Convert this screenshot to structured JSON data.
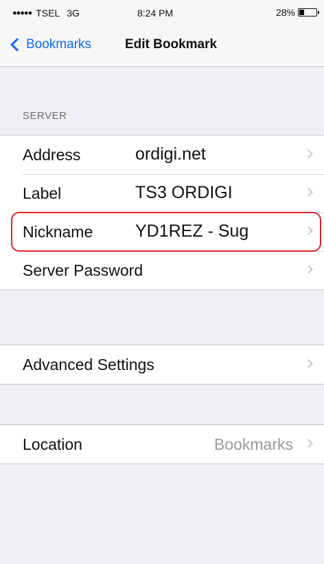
{
  "status_bar": {
    "signal": "●●●●●",
    "carrier": "TSEL",
    "network": "3G",
    "time": "8:24 PM",
    "battery": "28%",
    "battery_level": 0.28
  },
  "nav": {
    "back_label": "Bookmarks",
    "title": "Edit Bookmark"
  },
  "server_section": {
    "header": "SERVER",
    "rows": [
      {
        "label": "Address",
        "value": "ordigi.net"
      },
      {
        "label": "Label",
        "value": "TS3 ORDIGI"
      },
      {
        "label": "Nickname",
        "value": "YD1REZ - Sug"
      },
      {
        "label": "Server Password",
        "value": ""
      }
    ]
  },
  "advanced_section": {
    "label": "Advanced Settings"
  },
  "location_section": {
    "label": "Location",
    "value": "Bookmarks"
  },
  "colors": {
    "accent": "#0a6bff",
    "highlight": "#e0252b"
  }
}
